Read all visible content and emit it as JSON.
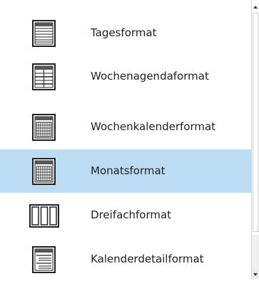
{
  "view_list": {
    "items": [
      {
        "label": "Tagesformat",
        "icon": "day-view-icon",
        "selected": false
      },
      {
        "label": "Wochenagendaformat",
        "icon": "week-agenda-icon",
        "selected": false
      },
      {
        "label": "Wochenkalenderformat",
        "icon": "week-calendar-icon",
        "selected": false
      },
      {
        "label": "Monatsformat",
        "icon": "month-view-icon",
        "selected": true
      },
      {
        "label": "Dreifachformat",
        "icon": "trifold-icon",
        "selected": false
      },
      {
        "label": "Kalenderdetailformat",
        "icon": "calendar-details-icon",
        "selected": false
      }
    ]
  },
  "colors": {
    "selected_bg": "#bcdcf4",
    "text": "#222222"
  }
}
